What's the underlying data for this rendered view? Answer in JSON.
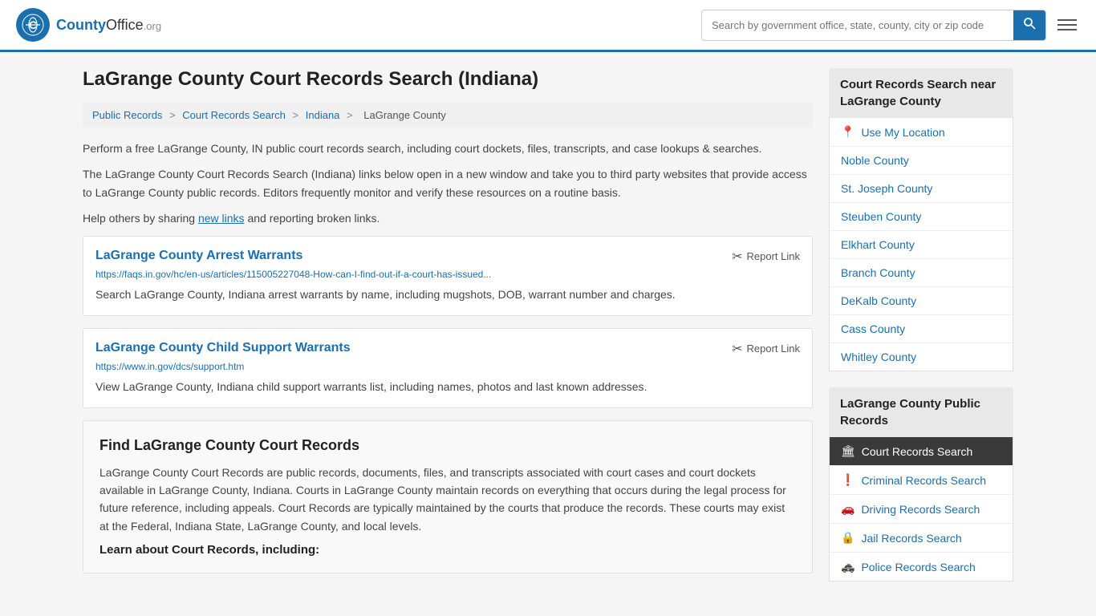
{
  "header": {
    "logo_text": "County",
    "logo_org": "Office",
    "logo_domain": ".org",
    "search_placeholder": "Search by government office, state, county, city or zip code",
    "menu_label": "Menu"
  },
  "page": {
    "title": "LaGrange County Court Records Search (Indiana)",
    "breadcrumb": {
      "items": [
        "Public Records",
        "Court Records Search",
        "Indiana",
        "LaGrange County"
      ]
    },
    "intro1": "Perform a free LaGrange County, IN public court records search, including court dockets, files, transcripts, and case lookups & searches.",
    "intro2": "The LaGrange County Court Records Search (Indiana) links below open in a new window and take you to third party websites that provide access to LaGrange County public records. Editors frequently monitor and verify these resources on a routine basis.",
    "intro3_pre": "Help others by sharing ",
    "intro3_link": "new links",
    "intro3_post": " and reporting broken links.",
    "records": [
      {
        "title": "LaGrange County Arrest Warrants",
        "url": "https://faqs.in.gov/hc/en-us/articles/115005227048-How-can-I-find-out-if-a-court-has-issued...",
        "desc": "Search LaGrange County, Indiana arrest warrants by name, including mugshots, DOB, warrant number and charges.",
        "report": "Report Link"
      },
      {
        "title": "LaGrange County Child Support Warrants",
        "url": "https://www.in.gov/dcs/support.htm",
        "desc": "View LaGrange County, Indiana child support warrants list, including names, photos and last known addresses.",
        "report": "Report Link"
      }
    ],
    "find_section": {
      "heading": "Find LaGrange County Court Records",
      "body": "LaGrange County Court Records are public records, documents, files, and transcripts associated with court cases and court dockets available in LaGrange County, Indiana. Courts in LaGrange County maintain records on everything that occurs during the legal process for future reference, including appeals. Court Records are typically maintained by the courts that produce the records. These courts may exist at the Federal, Indiana State, LaGrange County, and local levels.",
      "learn_heading": "Learn about Court Records, including:"
    }
  },
  "sidebar": {
    "nearby_heading": "Court Records Search near LaGrange County",
    "use_location": "Use My Location",
    "nearby_counties": [
      "Noble County",
      "St. Joseph County",
      "Steuben County",
      "Elkhart County",
      "Branch County",
      "DeKalb County",
      "Cass County",
      "Whitley County"
    ],
    "public_records_heading": "LaGrange County Public Records",
    "public_records": [
      {
        "label": "Court Records Search",
        "icon": "🏛",
        "active": true
      },
      {
        "label": "Criminal Records Search",
        "icon": "❗",
        "active": false
      },
      {
        "label": "Driving Records Search",
        "icon": "🚗",
        "active": false
      },
      {
        "label": "Jail Records Search",
        "icon": "🔒",
        "active": false
      },
      {
        "label": "Police Records Search",
        "icon": "🚓",
        "active": false
      }
    ]
  }
}
